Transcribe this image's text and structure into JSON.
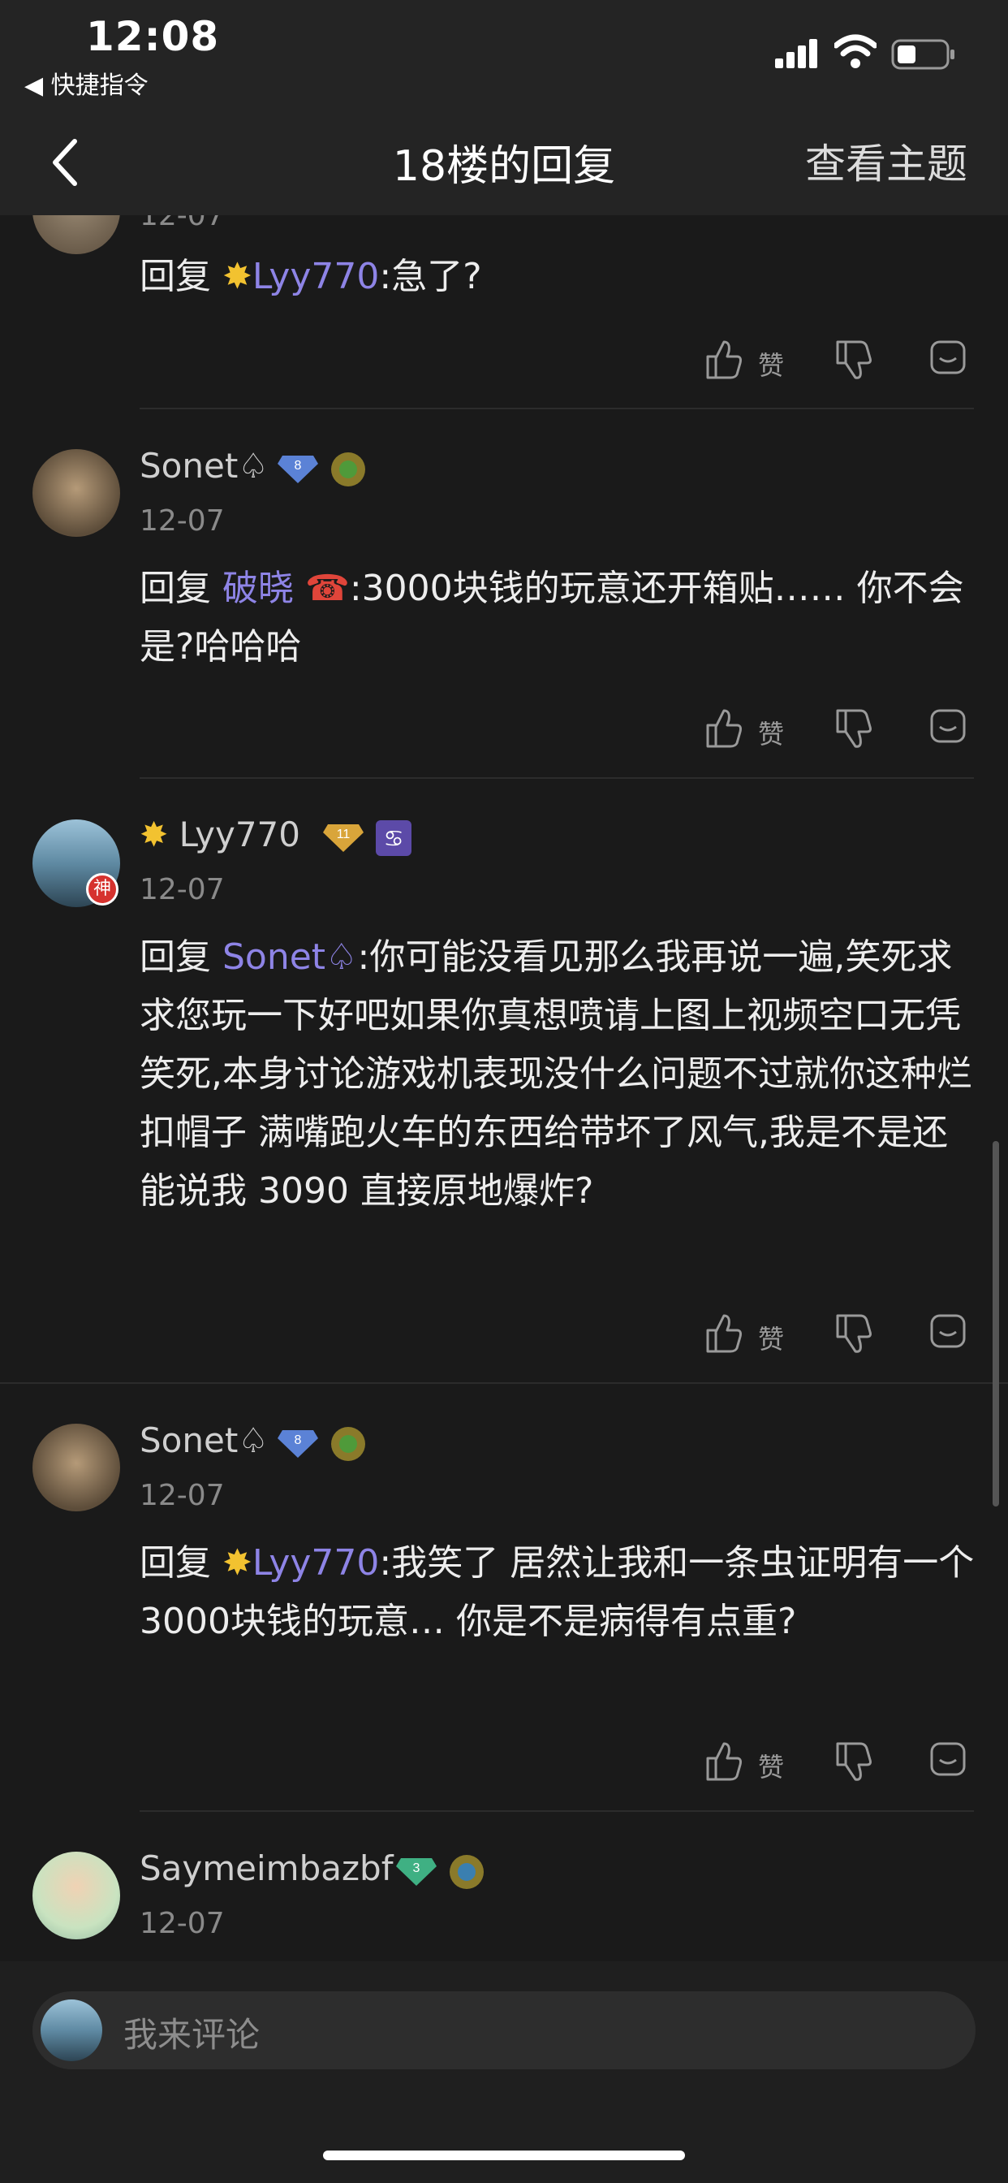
{
  "status": {
    "time": "12:08",
    "back_app": "◀ 快捷指令"
  },
  "nav": {
    "title": "18楼的回复",
    "right_label": "查看主题"
  },
  "posts": [
    {
      "reply_prefix": "回复",
      "mention": "Lyy770",
      "text": ":急了?"
    },
    {
      "username": "Sonet♤",
      "level": "8",
      "date": "12-07",
      "reply_prefix": "回复",
      "mention": "破晓",
      "text": ":3000块钱的玩意还开箱贴…… 你不会是?哈哈哈"
    },
    {
      "username": "Lyy770",
      "level": "11",
      "date": "12-07",
      "avatar_badge": "神",
      "reply_prefix": "回复",
      "mention": "Sonet♤",
      "text": ":你可能没看见那么我再说一遍,笑死求求您玩一下好吧如果你真想喷请上图上视频空口无凭笑死,本身讨论游戏机表现没什么问题不过就你这种烂扣帽子 满嘴跑火车的东西给带坏了风气,我是不是还能说我 3090 直接原地爆炸?"
    },
    {
      "username": "Sonet♤",
      "level": "8",
      "date": "12-07",
      "reply_prefix": "回复",
      "mention": "Lyy770",
      "text": ":我笑了 居然让我和一条虫证明有一个3000块钱的玩意… 你是不是病得有点重?"
    },
    {
      "username": "Saymeimbazbf",
      "level": "3",
      "date": "12-07"
    }
  ],
  "actions": {
    "like_label": "赞"
  },
  "comment": {
    "placeholder": "我来评论"
  },
  "colors": {
    "mention": "#8e84e6",
    "level_blue": "#5b82d6",
    "level_gold": "#d9a53a",
    "level_green": "#3fb083"
  }
}
